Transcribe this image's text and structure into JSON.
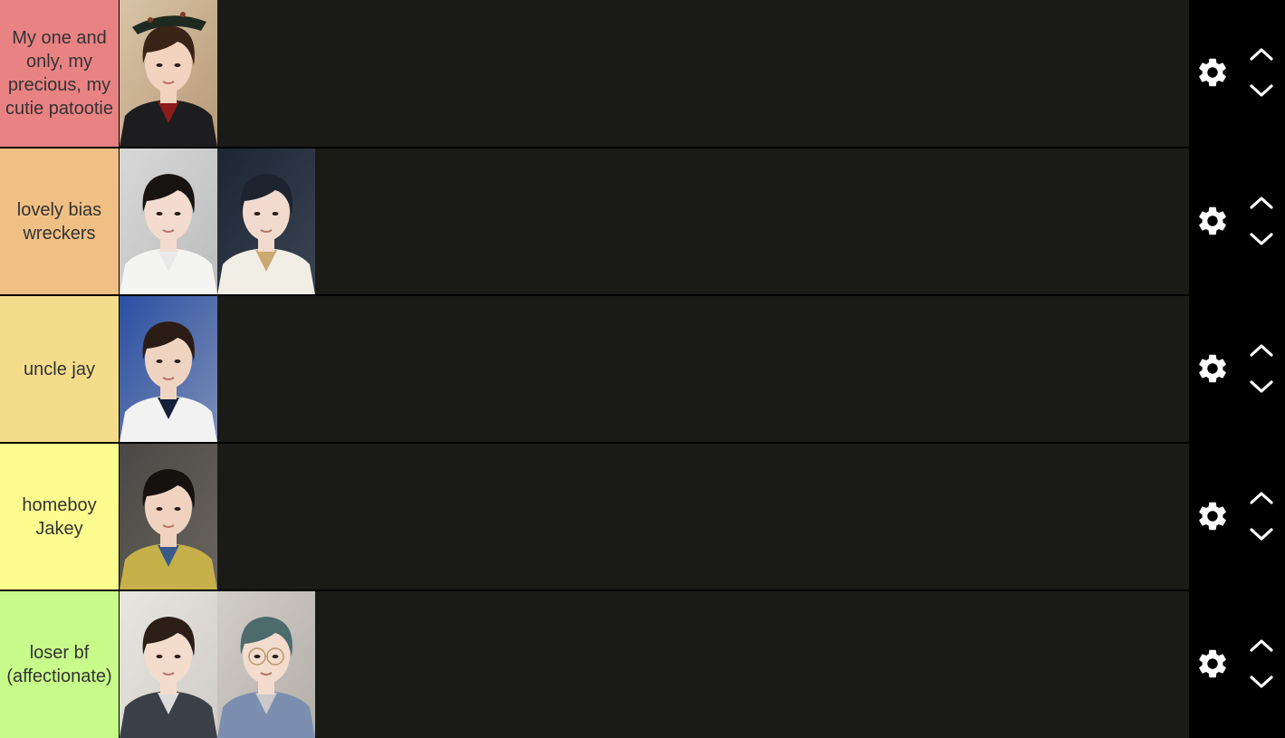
{
  "tiers": [
    {
      "label": "My one and only, my precious, my cutie patootie",
      "color": "#e98283",
      "items": [
        {
          "name": "selfie-black-hat-red-tie"
        }
      ]
    },
    {
      "label": "lovely bias wreckers",
      "color": "#f0bf84",
      "items": [
        {
          "name": "selfie-white-shirt-peace-sign"
        },
        {
          "name": "selfie-white-embroidered-jacket"
        }
      ]
    },
    {
      "label": "uncle jay",
      "color": "#f3dc8a",
      "items": [
        {
          "name": "selfie-blue-background-navy-tie"
        }
      ]
    },
    {
      "label": "homeboy Jakey",
      "color": "#fdfd8f",
      "items": [
        {
          "name": "selfie-plaid-shirt-hand-pose"
        }
      ]
    },
    {
      "label": "loser bf (affectionate)",
      "color": "#c8fc8a",
      "items": [
        {
          "name": "selfie-grey-jacket"
        },
        {
          "name": "selfie-glasses-checked-shirt"
        }
      ]
    }
  ],
  "controls": {
    "settings_icon": "gear-icon",
    "move_up_icon": "chevron-up-icon",
    "move_down_icon": "chevron-down-icon"
  },
  "colors": {
    "row_background": "#1a1a17",
    "page_background": "#000000",
    "label_text": "#333333",
    "icon": "#ffffff"
  }
}
